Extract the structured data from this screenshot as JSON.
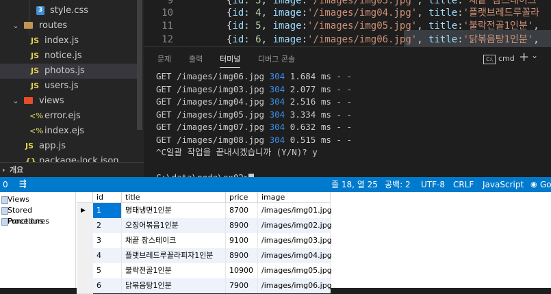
{
  "explorer": {
    "items": [
      {
        "label": "style.css",
        "icon": "css-file-icon",
        "type": "css"
      },
      {
        "label": "routes",
        "icon": "folder-icon",
        "type": "folder"
      },
      {
        "label": "index.js",
        "icon": "js-file-icon",
        "type": "js"
      },
      {
        "label": "notice.js",
        "icon": "js-file-icon",
        "type": "js"
      },
      {
        "label": "photos.js",
        "icon": "js-file-icon",
        "type": "js"
      },
      {
        "label": "users.js",
        "icon": "js-file-icon",
        "type": "js"
      },
      {
        "label": "views",
        "icon": "folder-icon",
        "type": "folder"
      },
      {
        "label": "error.ejs",
        "icon": "ejs-file-icon",
        "type": "ejs"
      },
      {
        "label": "index.ejs",
        "icon": "ejs-file-icon",
        "type": "ejs"
      },
      {
        "label": "app.js",
        "icon": "js-file-icon",
        "type": "js"
      },
      {
        "label": "package-lock.json",
        "icon": "json-file-icon",
        "type": "json"
      }
    ],
    "js_badge": "JS",
    "ejs_badge": "<%",
    "css_badge": "3"
  },
  "outline": {
    "label": "개요"
  },
  "editor": {
    "lines": [
      {
        "num": "9",
        "id": "3",
        "image": "'/images/img03.jpg'",
        "title": "'채끝 참스테이크"
      },
      {
        "num": "10",
        "id": "4",
        "image": "'/images/img04.jpg'",
        "title": "'플랫브레드루꼴라"
      },
      {
        "num": "11",
        "id": "5",
        "image": "'/images/img05.jpg'",
        "title": "'불락전골1인분'"
      },
      {
        "num": "12",
        "id": "6",
        "image": "'/images/img06.jpg'",
        "title": "'닭볶음탕1인분'"
      }
    ]
  },
  "panel": {
    "tabs": [
      "문제",
      "출력",
      "터미널",
      "디버그 콘솔"
    ],
    "active_tab": "터미널",
    "shell": "cmd",
    "plus": "+",
    "chevron": "⌄",
    "more": "···",
    "terminal": {
      "requests": [
        {
          "method": "GET",
          "path": "/images/img06.jpg",
          "code": "304",
          "time": "1.684 ms - -"
        },
        {
          "method": "GET",
          "path": "/images/img03.jpg",
          "code": "304",
          "time": "2.077 ms - -"
        },
        {
          "method": "GET",
          "path": "/images/img04.jpg",
          "code": "304",
          "time": "2.516 ms - -"
        },
        {
          "method": "GET",
          "path": "/images/img05.jpg",
          "code": "304",
          "time": "3.334 ms - -"
        },
        {
          "method": "GET",
          "path": "/images/img07.jpg",
          "code": "304",
          "time": "0.632 ms - -"
        },
        {
          "method": "GET",
          "path": "/images/img08.jpg",
          "code": "304",
          "time": "0.515 ms - -"
        }
      ],
      "prompt_line": "^C일괄 작업을 끝내시겠습니까 (Y/N)? y",
      "cwd_line": "C:\\data\\node\\ex02>"
    }
  },
  "statusbar": {
    "left_count": "0",
    "position": "줄 18, 열 25",
    "indent": "공백: 2",
    "encoding": "UTF-8",
    "eol": "CRLF",
    "language": "JavaScript",
    "golive": "Go"
  },
  "db": {
    "sidebar": [
      "Views",
      "Stored Procedures",
      "Functions"
    ],
    "columns": [
      "id",
      "title",
      "price",
      "image"
    ],
    "rows": [
      {
        "id": "1",
        "title": "명태냉면1인분",
        "price": "8700",
        "image": "/images/img01.jpg"
      },
      {
        "id": "2",
        "title": "오징어볶음1인분",
        "price": "8900",
        "image": "/images/img02.jpg"
      },
      {
        "id": "3",
        "title": "채끝 참스테이크",
        "price": "9100",
        "image": "/images/img03.jpg"
      },
      {
        "id": "4",
        "title": "플랫브레드루꼴라피자1인분",
        "price": "8900",
        "image": "/images/img04.jpg"
      },
      {
        "id": "5",
        "title": "불락전골1인분",
        "price": "10900",
        "image": "/images/img05.jpg"
      },
      {
        "id": "6",
        "title": "닭볶음탕1인분",
        "price": "7900",
        "image": "/images/img06.jpg"
      }
    ]
  },
  "colors": {
    "accent": "#007acc",
    "selection": "#0078d7",
    "terminal_code": "#3b8eea"
  }
}
